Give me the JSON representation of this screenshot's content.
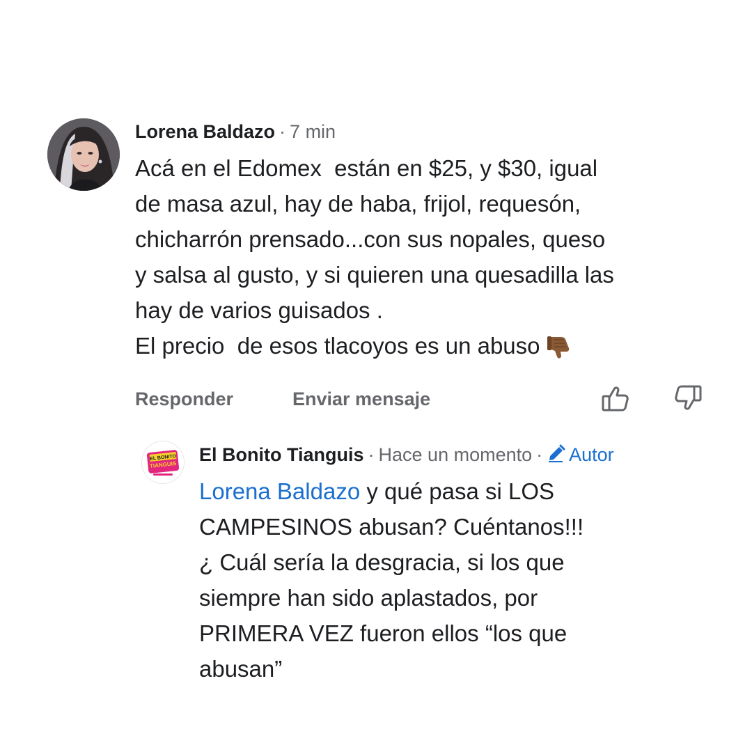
{
  "comment": {
    "author": "Lorena Baldazo",
    "time": "7 min",
    "separator": "·",
    "lines": [
      "Acá en el Edomex  están en $25, y $30, igual",
      "de masa azul, hay de haba, frijol, requesón,",
      "chicharrón prensado...con sus nopales, queso",
      "y salsa al gusto, y si quieren una quesadilla las",
      "hay de varios guisados .",
      "El precio  de esos tlacoyos es un abuso"
    ],
    "emoji": "thumbs-down-icon",
    "actions": {
      "reply_label": "Responder",
      "message_label": "Enviar mensaje"
    }
  },
  "reply": {
    "author": "El Bonito Tianguis",
    "time": "Hace un momento",
    "separator": "·",
    "badge_label": "Autor",
    "mention": "Lorena Baldazo",
    "first_line_rest": " y qué pasa si LOS",
    "lines": [
      "CAMPESINOS abusan? Cuéntanos!!!",
      "¿ Cuál sería la desgracia, si los que",
      "siempre han sido aplastados, por",
      "PRIMERA VEZ fueron ellos “los que",
      "abusan”"
    ],
    "avatar_logo": {
      "line1": "EL BONITO",
      "line2": "TIANGUIS"
    }
  },
  "colors": {
    "text": "#1c1e21",
    "meta": "#65676b",
    "link": "#1a6fd1",
    "logo_pink": "#e2267e",
    "logo_yellow": "#f6d12a",
    "emoji_brown": "#8a5a34"
  }
}
